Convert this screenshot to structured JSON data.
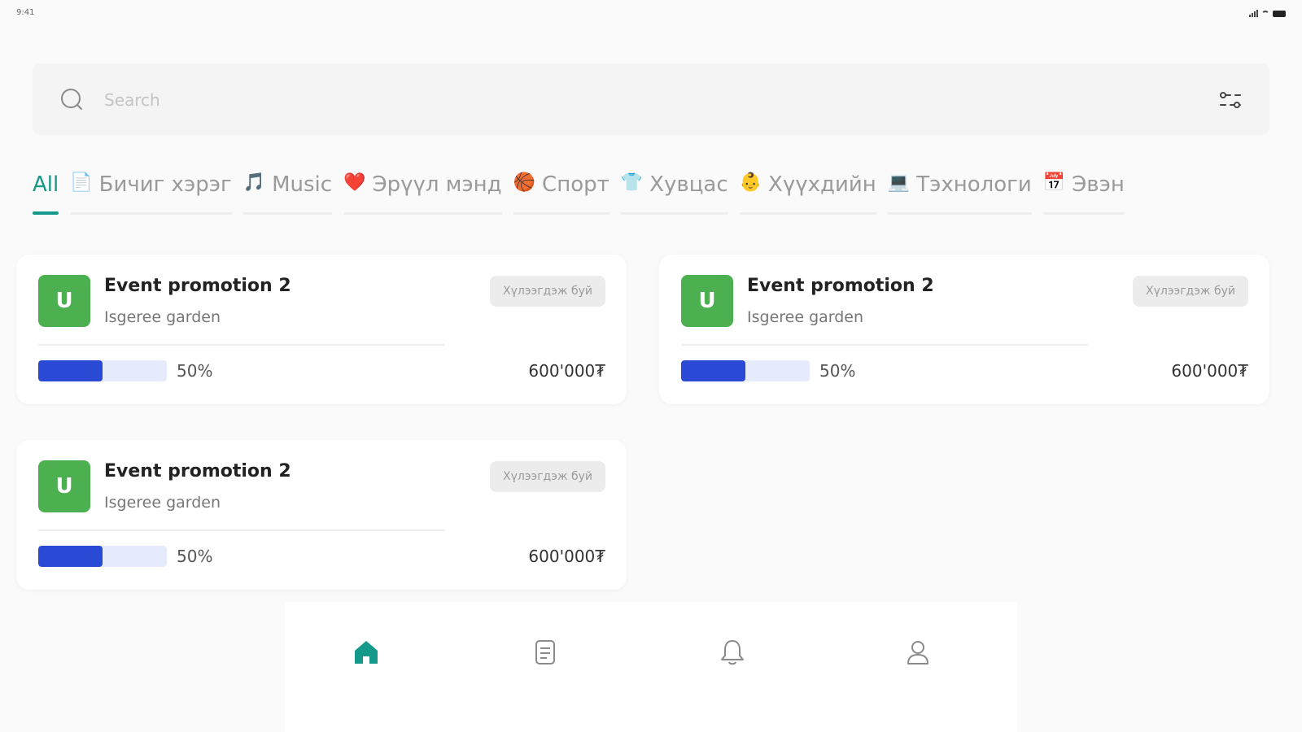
{
  "status_bar": {
    "time": "9:41"
  },
  "search": {
    "placeholder": "Search",
    "value": ""
  },
  "categories": [
    {
      "emoji": "",
      "label": "All",
      "active": true
    },
    {
      "emoji": "📄",
      "label": "Бичиг хэрэг",
      "active": false
    },
    {
      "emoji": "🎵",
      "label": "Music",
      "active": false
    },
    {
      "emoji": "❤️",
      "label": "Эрүүл мэнд",
      "active": false
    },
    {
      "emoji": "🏀",
      "label": "Спорт",
      "active": false
    },
    {
      "emoji": "👕",
      "label": "Хувцас",
      "active": false
    },
    {
      "emoji": "👶",
      "label": "Хүүхдийн",
      "active": false
    },
    {
      "emoji": "💻",
      "label": "Тэхнологи",
      "active": false
    },
    {
      "emoji": "📅",
      "label": "Эвэн",
      "active": false
    }
  ],
  "cards": [
    {
      "avatar": "U",
      "title": "Event promotion 2",
      "subtitle": "Isgeree garden",
      "badge": "Хүлээгдэж буй",
      "progress": 0.5,
      "progress_label": "50%",
      "amount": "600'000₮"
    },
    {
      "avatar": "U",
      "title": "Event promotion 2",
      "subtitle": "Isgeree garden",
      "badge": "Хүлээгдэж буй",
      "progress": 0.5,
      "progress_label": "50%",
      "amount": "600'000₮"
    },
    {
      "avatar": "U",
      "title": "Event promotion 2",
      "subtitle": "Isgeree garden",
      "badge": "Хүлээгдэж буй",
      "progress": 0.5,
      "progress_label": "50%",
      "amount": "600'000₮"
    }
  ],
  "bottom_nav": [
    {
      "icon": "home-icon",
      "active": true
    },
    {
      "icon": "document-icon",
      "active": false
    },
    {
      "icon": "bell-icon",
      "active": false
    },
    {
      "icon": "user-icon",
      "active": false
    }
  ],
  "colors": {
    "accent": "#14998a",
    "avatar": "#4caf50",
    "progress": "#2a4ad6",
    "progress_track": "#e6ebfb"
  }
}
